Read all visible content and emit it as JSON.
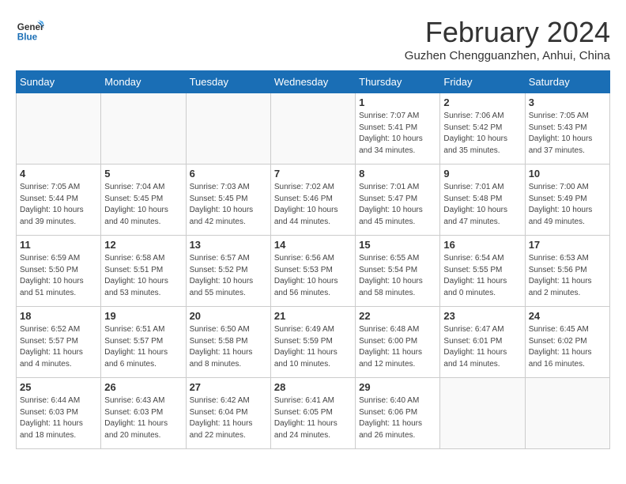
{
  "header": {
    "logo_line1": "General",
    "logo_line2": "Blue",
    "month": "February 2024",
    "location": "Guzhen Chengguanzhen, Anhui, China"
  },
  "days_of_week": [
    "Sunday",
    "Monday",
    "Tuesday",
    "Wednesday",
    "Thursday",
    "Friday",
    "Saturday"
  ],
  "weeks": [
    [
      {
        "day": "",
        "info": ""
      },
      {
        "day": "",
        "info": ""
      },
      {
        "day": "",
        "info": ""
      },
      {
        "day": "",
        "info": ""
      },
      {
        "day": "1",
        "info": "Sunrise: 7:07 AM\nSunset: 5:41 PM\nDaylight: 10 hours\nand 34 minutes."
      },
      {
        "day": "2",
        "info": "Sunrise: 7:06 AM\nSunset: 5:42 PM\nDaylight: 10 hours\nand 35 minutes."
      },
      {
        "day": "3",
        "info": "Sunrise: 7:05 AM\nSunset: 5:43 PM\nDaylight: 10 hours\nand 37 minutes."
      }
    ],
    [
      {
        "day": "4",
        "info": "Sunrise: 7:05 AM\nSunset: 5:44 PM\nDaylight: 10 hours\nand 39 minutes."
      },
      {
        "day": "5",
        "info": "Sunrise: 7:04 AM\nSunset: 5:45 PM\nDaylight: 10 hours\nand 40 minutes."
      },
      {
        "day": "6",
        "info": "Sunrise: 7:03 AM\nSunset: 5:45 PM\nDaylight: 10 hours\nand 42 minutes."
      },
      {
        "day": "7",
        "info": "Sunrise: 7:02 AM\nSunset: 5:46 PM\nDaylight: 10 hours\nand 44 minutes."
      },
      {
        "day": "8",
        "info": "Sunrise: 7:01 AM\nSunset: 5:47 PM\nDaylight: 10 hours\nand 45 minutes."
      },
      {
        "day": "9",
        "info": "Sunrise: 7:01 AM\nSunset: 5:48 PM\nDaylight: 10 hours\nand 47 minutes."
      },
      {
        "day": "10",
        "info": "Sunrise: 7:00 AM\nSunset: 5:49 PM\nDaylight: 10 hours\nand 49 minutes."
      }
    ],
    [
      {
        "day": "11",
        "info": "Sunrise: 6:59 AM\nSunset: 5:50 PM\nDaylight: 10 hours\nand 51 minutes."
      },
      {
        "day": "12",
        "info": "Sunrise: 6:58 AM\nSunset: 5:51 PM\nDaylight: 10 hours\nand 53 minutes."
      },
      {
        "day": "13",
        "info": "Sunrise: 6:57 AM\nSunset: 5:52 PM\nDaylight: 10 hours\nand 55 minutes."
      },
      {
        "day": "14",
        "info": "Sunrise: 6:56 AM\nSunset: 5:53 PM\nDaylight: 10 hours\nand 56 minutes."
      },
      {
        "day": "15",
        "info": "Sunrise: 6:55 AM\nSunset: 5:54 PM\nDaylight: 10 hours\nand 58 minutes."
      },
      {
        "day": "16",
        "info": "Sunrise: 6:54 AM\nSunset: 5:55 PM\nDaylight: 11 hours\nand 0 minutes."
      },
      {
        "day": "17",
        "info": "Sunrise: 6:53 AM\nSunset: 5:56 PM\nDaylight: 11 hours\nand 2 minutes."
      }
    ],
    [
      {
        "day": "18",
        "info": "Sunrise: 6:52 AM\nSunset: 5:57 PM\nDaylight: 11 hours\nand 4 minutes."
      },
      {
        "day": "19",
        "info": "Sunrise: 6:51 AM\nSunset: 5:57 PM\nDaylight: 11 hours\nand 6 minutes."
      },
      {
        "day": "20",
        "info": "Sunrise: 6:50 AM\nSunset: 5:58 PM\nDaylight: 11 hours\nand 8 minutes."
      },
      {
        "day": "21",
        "info": "Sunrise: 6:49 AM\nSunset: 5:59 PM\nDaylight: 11 hours\nand 10 minutes."
      },
      {
        "day": "22",
        "info": "Sunrise: 6:48 AM\nSunset: 6:00 PM\nDaylight: 11 hours\nand 12 minutes."
      },
      {
        "day": "23",
        "info": "Sunrise: 6:47 AM\nSunset: 6:01 PM\nDaylight: 11 hours\nand 14 minutes."
      },
      {
        "day": "24",
        "info": "Sunrise: 6:45 AM\nSunset: 6:02 PM\nDaylight: 11 hours\nand 16 minutes."
      }
    ],
    [
      {
        "day": "25",
        "info": "Sunrise: 6:44 AM\nSunset: 6:03 PM\nDaylight: 11 hours\nand 18 minutes."
      },
      {
        "day": "26",
        "info": "Sunrise: 6:43 AM\nSunset: 6:03 PM\nDaylight: 11 hours\nand 20 minutes."
      },
      {
        "day": "27",
        "info": "Sunrise: 6:42 AM\nSunset: 6:04 PM\nDaylight: 11 hours\nand 22 minutes."
      },
      {
        "day": "28",
        "info": "Sunrise: 6:41 AM\nSunset: 6:05 PM\nDaylight: 11 hours\nand 24 minutes."
      },
      {
        "day": "29",
        "info": "Sunrise: 6:40 AM\nSunset: 6:06 PM\nDaylight: 11 hours\nand 26 minutes."
      },
      {
        "day": "",
        "info": ""
      },
      {
        "day": "",
        "info": ""
      }
    ]
  ]
}
